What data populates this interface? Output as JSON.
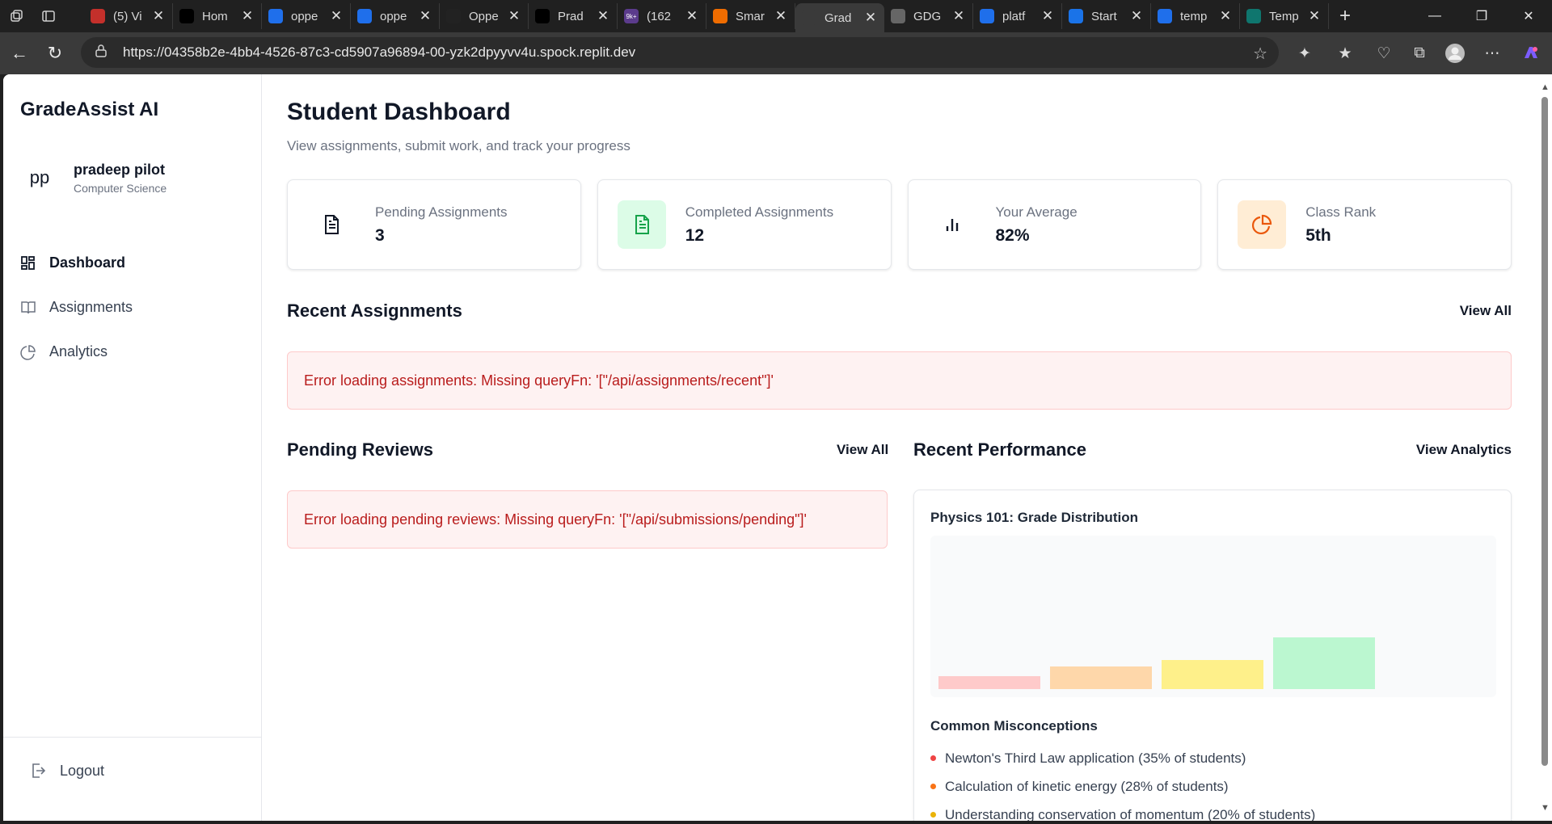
{
  "browser": {
    "tabs": [
      {
        "label": "(5) Vi",
        "icon": "youtube-icon",
        "color": "#c4302b"
      },
      {
        "label": "Hom",
        "icon": "x-icon",
        "color": "#000000"
      },
      {
        "label": "oppe",
        "icon": "search-icon",
        "color": "#1f6feb"
      },
      {
        "label": "oppe",
        "icon": "search-icon",
        "color": "#1f6feb"
      },
      {
        "label": "Oppe",
        "icon": "bird-icon",
        "color": "#222222"
      },
      {
        "label": "Prad",
        "icon": "x-icon",
        "color": "#000000"
      },
      {
        "label": "(162",
        "icon": "notification-icon",
        "color": "#5b3b8c"
      },
      {
        "label": "Smar",
        "icon": "smar-icon",
        "color": "#ef6c00"
      },
      {
        "label": "Grad",
        "icon": "globe-icon",
        "color": "#3a3a3a"
      },
      {
        "label": "GDG",
        "icon": "gdg-icon",
        "color": "#666666"
      },
      {
        "label": "platf",
        "icon": "search-icon",
        "color": "#1f6feb"
      },
      {
        "label": "Start",
        "icon": "react-icon",
        "color": "#1a73e8"
      },
      {
        "label": "temp",
        "icon": "search-icon",
        "color": "#1f6feb"
      },
      {
        "label": "Temp",
        "icon": "template-icon",
        "color": "#0f766e"
      }
    ],
    "notification_badge": "9k+",
    "url": "https://04358b2e-4bb4-4526-87c3-cd5907a96894-00-yzk2dpyyvv4u.spock.replit.dev"
  },
  "sidebar": {
    "brand": "GradeAssist AI",
    "user": {
      "initials": "pp",
      "name": "pradeep pilot",
      "department": "Computer Science"
    },
    "nav": [
      {
        "label": "Dashboard",
        "icon": "dashboard-icon",
        "active": true
      },
      {
        "label": "Assignments",
        "icon": "book-icon",
        "active": false
      },
      {
        "label": "Analytics",
        "icon": "pie-chart-icon",
        "active": false
      }
    ],
    "logout": "Logout"
  },
  "header": {
    "title": "Student Dashboard",
    "subtitle": "View assignments, submit work, and track your progress"
  },
  "stats": [
    {
      "label": "Pending Assignments",
      "value": "3",
      "icon": "document-icon",
      "bg": "#ffffff",
      "fg": "#111827"
    },
    {
      "label": "Completed Assignments",
      "value": "12",
      "icon": "document-check-icon",
      "bg": "#dcfce7",
      "fg": "#16a34a"
    },
    {
      "label": "Your Average",
      "value": "82%",
      "icon": "bar-chart-icon",
      "bg": "#ffffff",
      "fg": "#111827"
    },
    {
      "label": "Class Rank",
      "value": "5th",
      "icon": "pie-chart-icon",
      "bg": "#ffedd5",
      "fg": "#ea580c"
    }
  ],
  "recent_assignments": {
    "title": "Recent Assignments",
    "view_all": "View All",
    "error": "Error loading assignments: Missing queryFn: '[\"/api/assignments/recent\"]'"
  },
  "pending_reviews": {
    "title": "Pending Reviews",
    "view_all": "View All",
    "error": "Error loading pending reviews: Missing queryFn: '[\"/api/submissions/pending\"]'"
  },
  "performance": {
    "title": "Recent Performance",
    "view_link": "View Analytics",
    "chart_title": "Physics 101: Grade Distribution",
    "misconceptions_title": "Common Misconceptions",
    "misconceptions": [
      {
        "text": "Newton's Third Law application (35% of students)",
        "color": "#ef4444"
      },
      {
        "text": "Calculation of kinetic energy (28% of students)",
        "color": "#f97316"
      },
      {
        "text": "Understanding conservation of momentum (20% of students)",
        "color": "#eab308"
      }
    ]
  },
  "chart_data": {
    "type": "bar",
    "title": "Physics 101: Grade Distribution",
    "categories": [
      "",
      "",
      "",
      ""
    ],
    "values": [
      8,
      14,
      18,
      32
    ],
    "colors": [
      "#fecaca",
      "#fed7aa",
      "#fef08a",
      "#bbf7d0"
    ],
    "ylim": [
      0,
      100
    ],
    "grid": false
  }
}
